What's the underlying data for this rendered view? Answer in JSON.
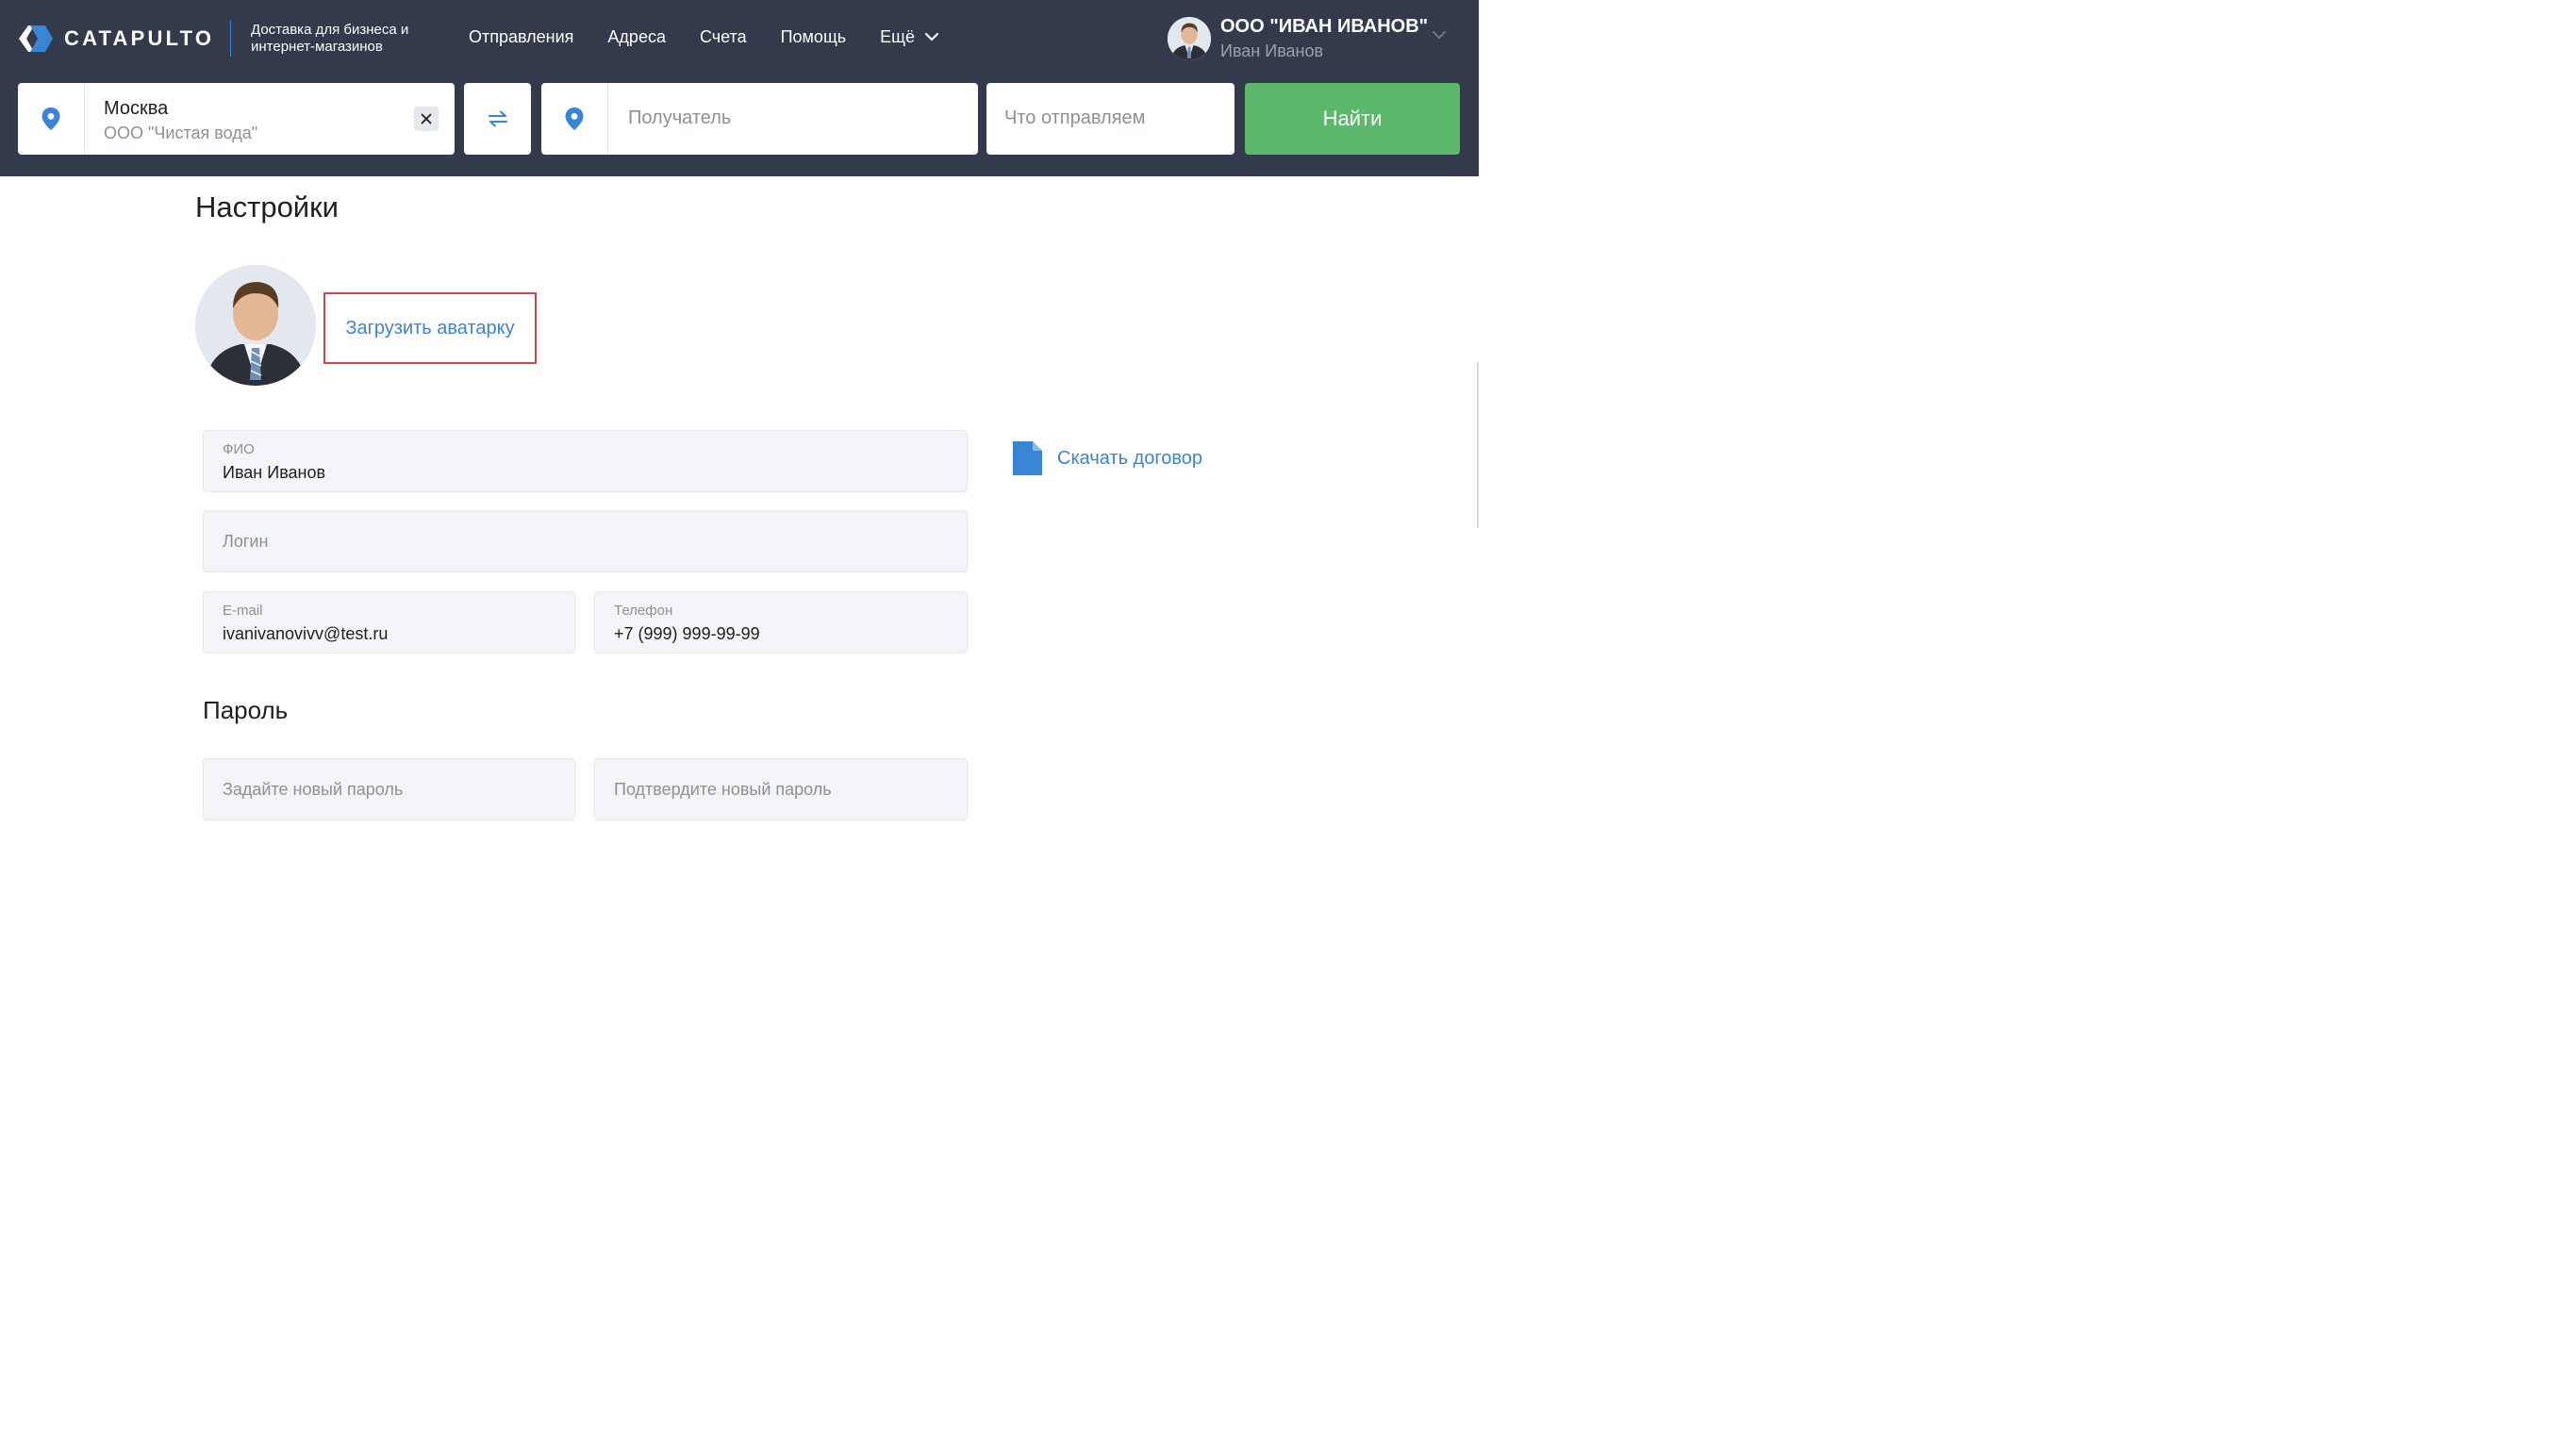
{
  "header": {
    "brand": "CATAPULTO",
    "tagline": "Доставка для бизнеса и интернет-магазинов",
    "nav": [
      {
        "label": "Отправления"
      },
      {
        "label": "Адреса"
      },
      {
        "label": "Счета"
      },
      {
        "label": "Помощь"
      }
    ],
    "more_label": "Ещё",
    "user": {
      "company": "ООО \"ИВАН ИВАНОВ\"",
      "name": "Иван Иванов"
    }
  },
  "search": {
    "from_city": "Москва",
    "from_org": "ООО \"Чистая вода\"",
    "to_placeholder": "Получатель",
    "what_placeholder": "Что отправляем",
    "find_label": "Найти"
  },
  "settings": {
    "title": "Настройки",
    "upload_avatar": "Загрузить аватарку",
    "fio_label": "ФИО",
    "fio_value": "Иван Иванов",
    "login_placeholder": "Логин",
    "email_label": "E-mail",
    "email_value": "ivanivanovivv@test.ru",
    "phone_label": "Телефон",
    "phone_value": "+7 (999) 999-99-99",
    "download_contract": "Скачать договор",
    "password_title": "Пароль",
    "new_password_placeholder": "Задайте новый пароль",
    "confirm_password_placeholder": "Подтвердите новый пароль"
  },
  "icons": {
    "logo": "catapulto-logo-icon",
    "pin": "map-pin-icon",
    "clear": "close-icon",
    "swap": "swap-arrows-icon",
    "chevron": "chevron-down-icon",
    "document": "document-icon",
    "avatar": "user-avatar-photo"
  },
  "colors": {
    "header_bg": "#333a4c",
    "accent_blue": "#3a84d6",
    "find_green": "#5cb86a",
    "highlight_red": "#d64545"
  }
}
